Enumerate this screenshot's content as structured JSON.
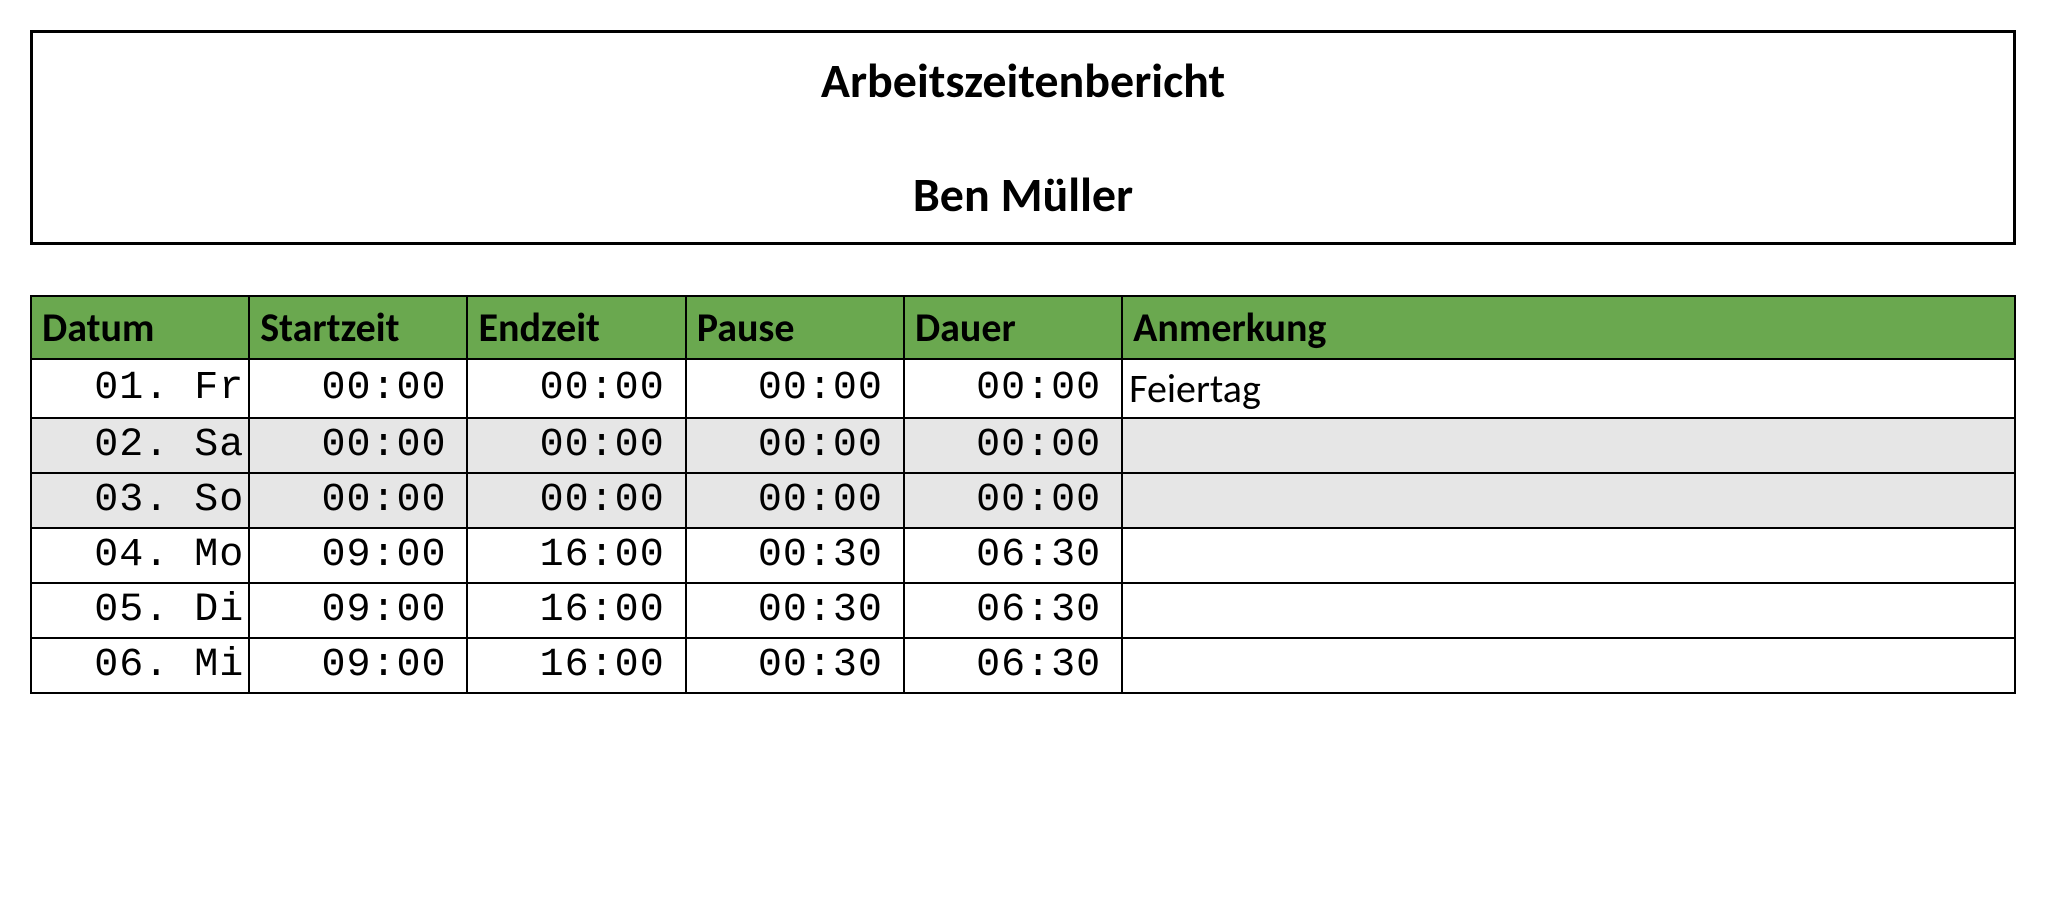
{
  "header": {
    "title": "Arbeitszeitenbericht",
    "name": "Ben Müller"
  },
  "table": {
    "columns": [
      "Datum",
      "Startzeit",
      "Endzeit",
      "Pause",
      "Dauer",
      "Anmerkung"
    ],
    "rows": [
      {
        "datum": "01. Fr",
        "start": "00:00",
        "end": "00:00",
        "pause": "00:00",
        "dauer": "00:00",
        "note": "Feiertag",
        "shaded": false
      },
      {
        "datum": "02. Sa",
        "start": "00:00",
        "end": "00:00",
        "pause": "00:00",
        "dauer": "00:00",
        "note": "",
        "shaded": true
      },
      {
        "datum": "03. So",
        "start": "00:00",
        "end": "00:00",
        "pause": "00:00",
        "dauer": "00:00",
        "note": "",
        "shaded": true
      },
      {
        "datum": "04. Mo",
        "start": "09:00",
        "end": "16:00",
        "pause": "00:30",
        "dauer": "06:30",
        "note": "",
        "shaded": false
      },
      {
        "datum": "05. Di",
        "start": "09:00",
        "end": "16:00",
        "pause": "00:30",
        "dauer": "06:30",
        "note": "",
        "shaded": false
      },
      {
        "datum": "06. Mi",
        "start": "09:00",
        "end": "16:00",
        "pause": "00:30",
        "dauer": "06:30",
        "note": "",
        "shaded": false
      }
    ]
  }
}
